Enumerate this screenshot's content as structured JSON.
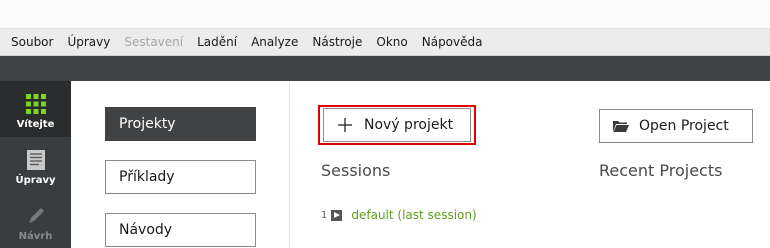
{
  "menubar": {
    "items": [
      {
        "label": "Soubor",
        "enabled": true
      },
      {
        "label": "Úpravy",
        "enabled": true
      },
      {
        "label": "Sestavení",
        "enabled": false
      },
      {
        "label": "Ladění",
        "enabled": true
      },
      {
        "label": "Analyze",
        "enabled": true
      },
      {
        "label": "Nástroje",
        "enabled": true
      },
      {
        "label": "Okno",
        "enabled": true
      },
      {
        "label": "Nápověda",
        "enabled": true
      }
    ]
  },
  "modes": [
    {
      "label": "Vítejte",
      "icon": "grid-icon",
      "active": true
    },
    {
      "label": "Úpravy",
      "icon": "document-icon",
      "active": false
    },
    {
      "label": "Návrh",
      "icon": "pencil-icon",
      "active": false
    }
  ],
  "welcome": {
    "sidebar": [
      {
        "label": "Projekty",
        "active": true
      },
      {
        "label": "Příklady",
        "active": false
      },
      {
        "label": "Návody",
        "active": false
      }
    ],
    "new_project_label": "Nový projekt",
    "open_project_label": "Open Project",
    "sessions_title": "Sessions",
    "recent_title": "Recent Projects",
    "sessions": [
      {
        "number": "1",
        "name": "default (last session)"
      }
    ]
  },
  "colors": {
    "highlight_border": "#e10000",
    "session_link": "#5a9e1e",
    "modebar": "#3a3d3f",
    "active_mode": "#2a2c2e"
  }
}
